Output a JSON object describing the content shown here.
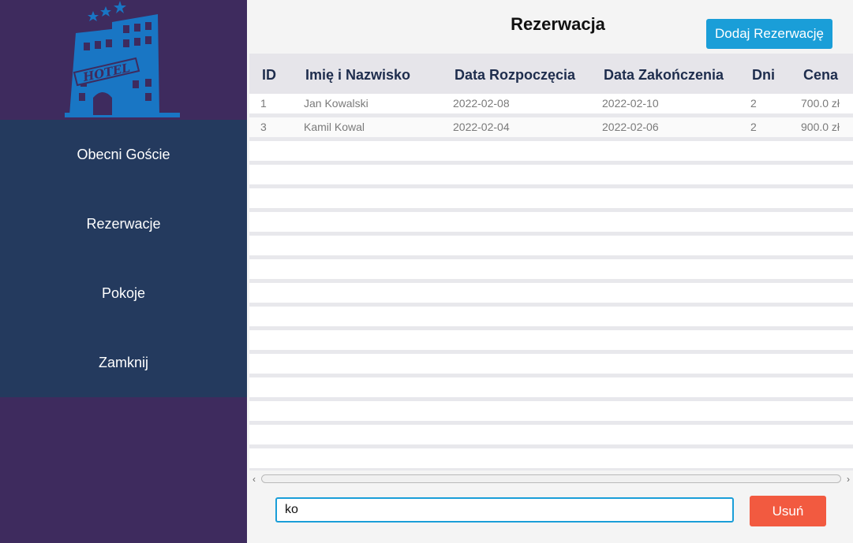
{
  "sidebar": {
    "logo_icon": "hotel-building-icon",
    "logo_text": "HOTEL",
    "items": [
      {
        "label": "Obecni Goście"
      },
      {
        "label": "Rezerwacje"
      },
      {
        "label": "Pokoje"
      },
      {
        "label": "Zamknij"
      }
    ]
  },
  "main": {
    "title": "Rezerwacja",
    "add_button": "Dodaj Rezerwację",
    "table": {
      "headers": {
        "id": "ID",
        "name": "Imię i Nazwisko",
        "start": "Data Rozpoczęcia",
        "end": "Data Zakończenia",
        "days": "Dni",
        "price": "Cena"
      },
      "rows": [
        {
          "id": "1",
          "name": "Jan Kowalski",
          "start": "2022-02-08",
          "end": "2022-02-10",
          "days": "2",
          "price": "700.0 zł"
        },
        {
          "id": "3",
          "name": "Kamil Kowal",
          "start": "2022-02-04",
          "end": "2022-02-06",
          "days": "2",
          "price": "900.0 zł"
        }
      ]
    },
    "search": {
      "value": "ko"
    },
    "delete_button": "Usuń"
  },
  "colors": {
    "sidebar_bg": "#3e2b5e",
    "nav_bg": "#243a5e",
    "accent": "#1a9ed8",
    "delete": "#f25a40",
    "header_text": "#1e2d4d"
  }
}
